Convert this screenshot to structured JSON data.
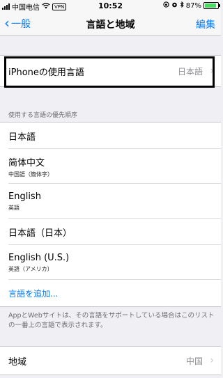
{
  "status_bar": {
    "carrier": "中国电信",
    "vpn": "VPN",
    "time": "10:52",
    "battery": "87%",
    "battery_level": 0.87,
    "icons": [
      "signal-icon",
      "wifi-icon",
      "lock-rotation-icon",
      "alarm-icon",
      "bluetooth-icon",
      "battery-icon"
    ]
  },
  "nav": {
    "back_label": "一般",
    "title": "言語と地域",
    "edit_label": "編集"
  },
  "device_language": {
    "label": "iPhoneの使用言語",
    "value": "日本語"
  },
  "preferred": {
    "header": "使用する言語の優先順序",
    "languages": [
      {
        "name": "日本語",
        "sub": ""
      },
      {
        "name": "简体中文",
        "sub": "中国語（簡体字）"
      },
      {
        "name": "English",
        "sub": "英語"
      },
      {
        "name": "日本語（日本）",
        "sub": ""
      },
      {
        "name": "English (U.S.)",
        "sub": "英語（アメリカ）"
      }
    ],
    "add_label": "言語を追加..."
  },
  "footer_note": "AppとWebサイトは、その言語をサポートしている場合はこのリストの一番上の言語で表示されます。",
  "region": {
    "label": "地域",
    "value": "中国"
  },
  "colors": {
    "accent": "#007aff",
    "background": "#efeff4",
    "battery": "#4cd964"
  }
}
